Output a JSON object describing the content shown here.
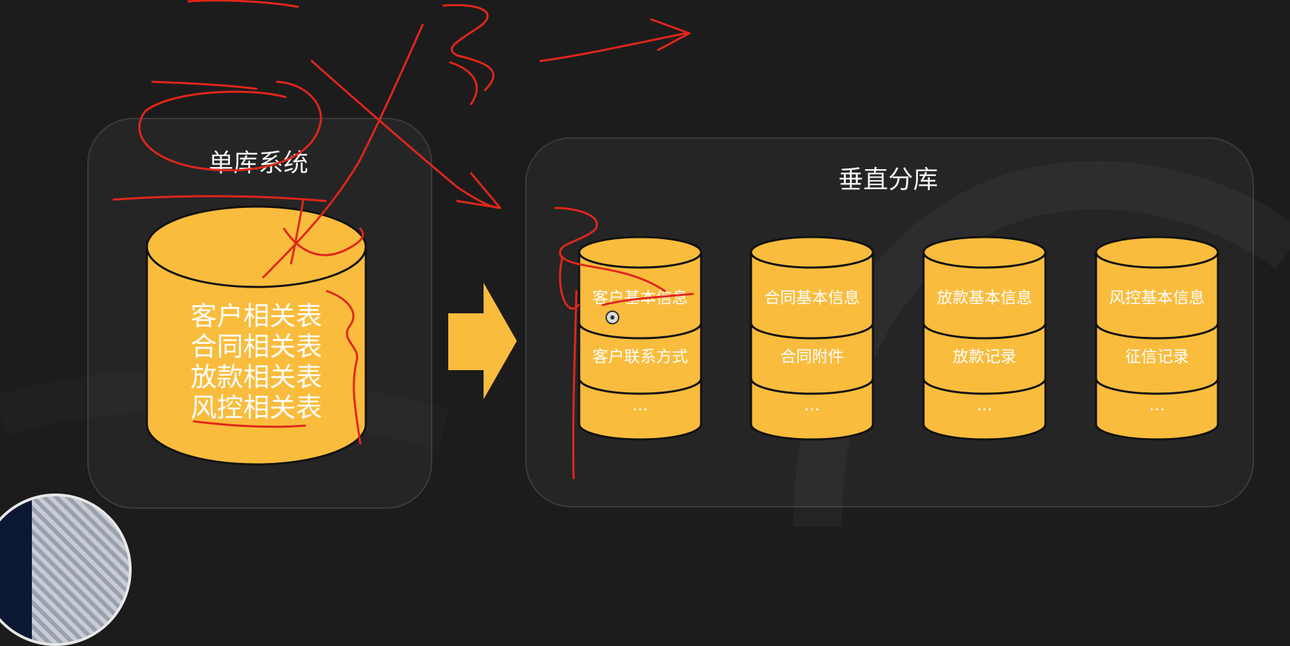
{
  "left_panel": {
    "title": "单库系统",
    "db_lines": [
      "客户相关表",
      "合同相关表",
      "放款相关表",
      "风控相关表"
    ]
  },
  "right_panel": {
    "title": "垂直分库",
    "databases": [
      {
        "rows": [
          "客户基本信息",
          "客户联系方式",
          "…"
        ]
      },
      {
        "rows": [
          "合同基本信息",
          "合同附件",
          "…"
        ]
      },
      {
        "rows": [
          "放款基本信息",
          "放款记录",
          "…"
        ]
      },
      {
        "rows": [
          "风控基本信息",
          "征信记录",
          "…"
        ]
      }
    ]
  },
  "colors": {
    "cylinder_fill": "#f9bc3d",
    "cylinder_stroke": "#111111",
    "annotation_ink": "#e0261b",
    "background": "#1c1c1c"
  }
}
